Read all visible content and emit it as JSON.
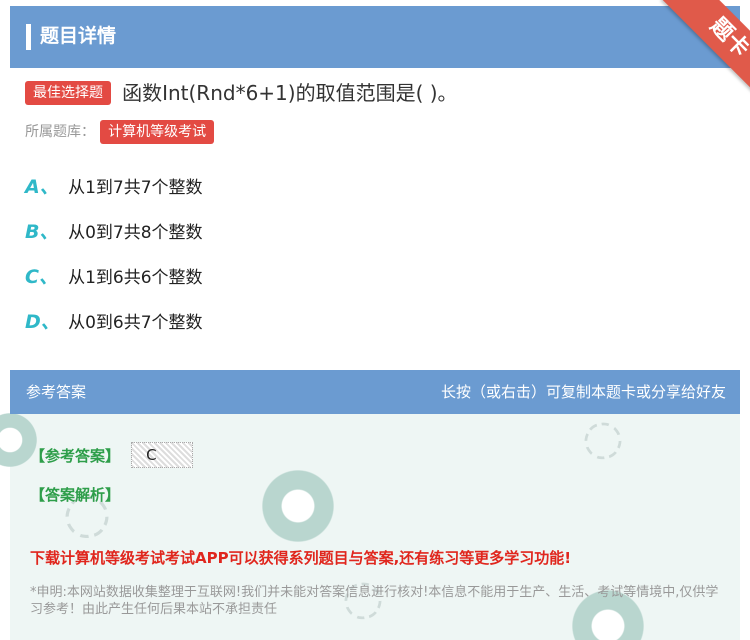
{
  "header": {
    "title": "题目详情"
  },
  "ribbon": {
    "label": "题卡"
  },
  "question": {
    "type_tag": "最佳选择题",
    "text": "函数Int(Rnd*6+1)的取值范围是( )。",
    "bank_label": "所属题库：",
    "bank_name": "计算机等级考试"
  },
  "options": [
    {
      "letter": "A、",
      "text": "从1到7共7个整数"
    },
    {
      "letter": "B、",
      "text": "从0到7共8个整数"
    },
    {
      "letter": "C、",
      "text": "从1到6共6个整数"
    },
    {
      "letter": "D、",
      "text": "从0到6共7个整数"
    }
  ],
  "answer": {
    "section_label": "参考答案",
    "hint": "长按（或右击）可复制本题卡或分享给好友",
    "answer_label": "【参考答案】",
    "answer_value": "C",
    "analysis_label": "【答案解析】",
    "promo": "下载计算机等级考试考试APP可以获得系列题目与答案,还有练习等更多学习功能!",
    "disclaimer": "*申明:本网站数据收集整理于互联网!我们并未能对答案信息进行核对!本信息不能用于生产、生活、考试等情境中,仅供学习参考！由此产生任何后果本站不承担责任"
  },
  "colors": {
    "header": "#6b9bd1",
    "tag": "#e34a43",
    "option_letter": "#2fb8c8",
    "answer_green": "#2e9e4a",
    "promo_red": "#e0261d"
  }
}
